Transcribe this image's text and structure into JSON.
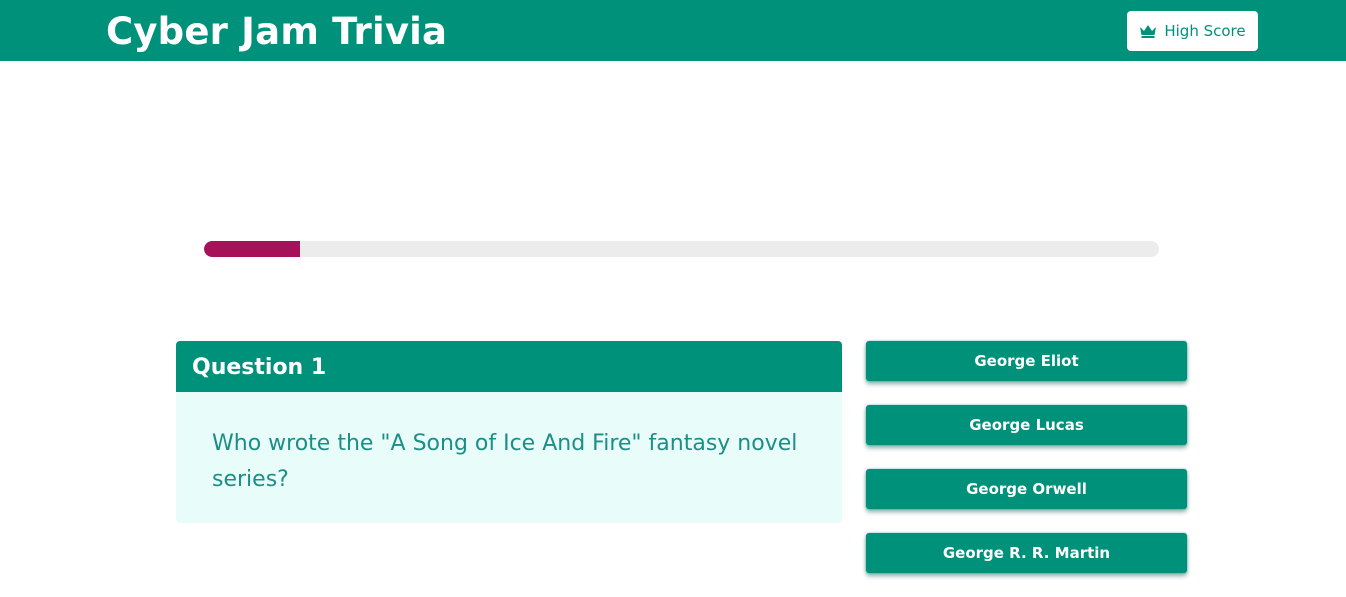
{
  "header": {
    "title": "Cyber Jam Trivia",
    "high_score_label": "High Score",
    "high_score_icon": "crown-icon"
  },
  "progress": {
    "fraction": 0.1
  },
  "question": {
    "heading": "Question 1",
    "text": "Who wrote the \"A Song of Ice And Fire\" fantasy novel series?"
  },
  "answers": [
    {
      "label": "George Eliot"
    },
    {
      "label": "George Lucas"
    },
    {
      "label": "George Orwell"
    },
    {
      "label": "George R. R. Martin"
    }
  ],
  "colors": {
    "primary": "#00917b",
    "progress_fill": "#a6125a",
    "progress_track": "#ececec",
    "card_body_bg": "#e8fcfa",
    "question_text": "#1b8f86"
  }
}
